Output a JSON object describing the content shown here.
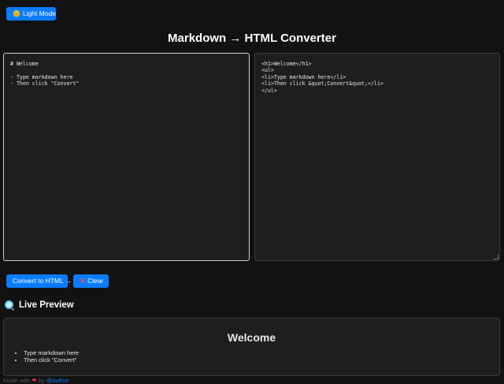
{
  "header": {
    "theme_button_icon": "sun-emoji",
    "theme_button_label": "Light Mode",
    "title": "Markdown → HTML Converter"
  },
  "editor": {
    "markdown_value": "# Welcome\n\n- Type markdown here\n- Then click \"Convert\"",
    "html_output_value": "<h1>Welcome</h1>\n<ul>\n<li>Type markdown here</li>\n<li>Then click &quot;Convert&quot;</li>\n</ul>"
  },
  "actions": {
    "convert_label": "Convert to HTML →",
    "clear_icon": "x-icon",
    "clear_label": "Clear"
  },
  "preview": {
    "heading": "Live Preview",
    "heading_icon": "magnifier-icon",
    "rendered_h1": "Welcome",
    "rendered_items": [
      "Type markdown here",
      "Then click \"Convert\""
    ]
  },
  "footer": {
    "prefix": "Made with",
    "heart_icon": "heart-icon",
    "by": "by",
    "author": "@author"
  },
  "colors": {
    "background": "#121212",
    "panel": "#1e1e1e",
    "accent": "#0a7cff"
  }
}
